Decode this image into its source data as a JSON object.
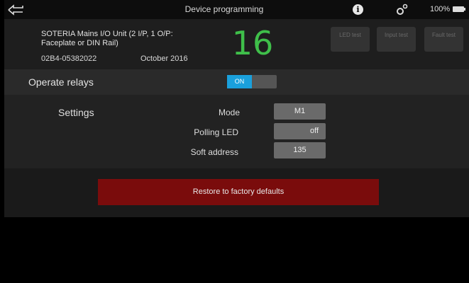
{
  "statusbar": {
    "title": "Device programming",
    "battery": "100%"
  },
  "device": {
    "name": "SOTERIA Mains I/O Unit (2 I/P, 1 O/P: Faceplate or DIN Rail)",
    "serial": "02B4-05382022",
    "date": "October 2016",
    "address": "16"
  },
  "header_buttons": [
    "LED test",
    "Input test",
    "Fault test"
  ],
  "relays": {
    "label": "Operate relays",
    "toggle_label": "ON"
  },
  "settings": {
    "label": "Settings",
    "mode_label": "Mode",
    "mode_value": "M1",
    "polling_label": "Polling LED",
    "polling_value": "off",
    "soft_label": "Soft address",
    "soft_value": "135"
  },
  "restore": {
    "label": "Restore to factory defaults"
  },
  "colors": {
    "address_green": "#3fbf4a",
    "toggle_blue": "#1aa0dc",
    "restore_red": "#7a0c0c"
  },
  "icons": [
    "back-arrow-icon",
    "info-icon",
    "settings-gear-icon",
    "battery-icon"
  ]
}
